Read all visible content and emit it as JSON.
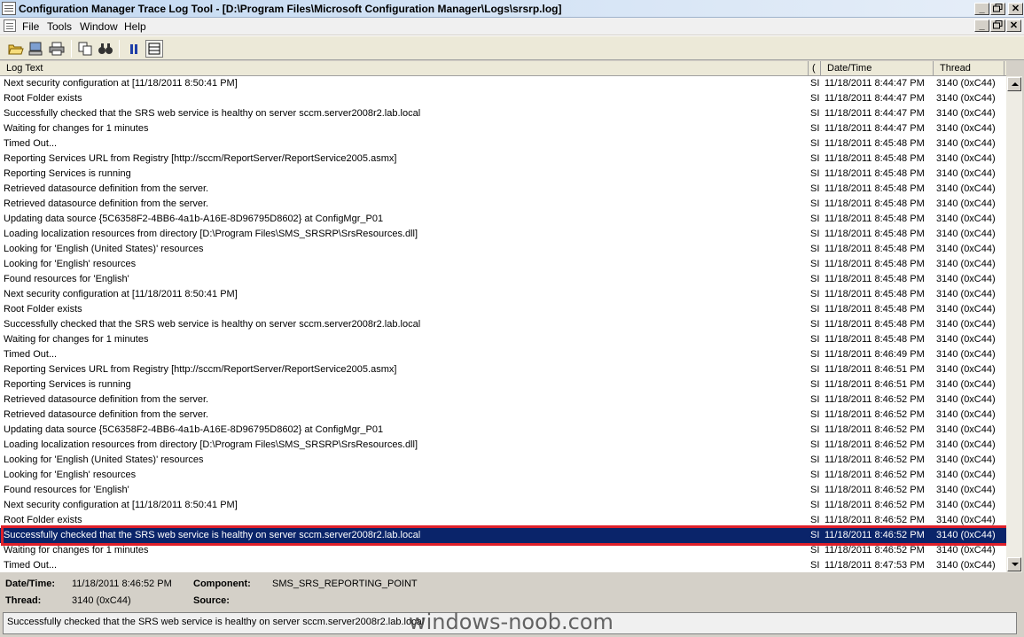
{
  "window": {
    "title": "Configuration Manager Trace Log Tool - [D:\\Program Files\\Microsoft Configuration Manager\\Logs\\srsrp.log]",
    "minimize_glyph": "_",
    "restore_glyph": "▫",
    "close_glyph": "✕"
  },
  "menu": [
    {
      "label": "File"
    },
    {
      "label": "Tools"
    },
    {
      "label": "Window"
    },
    {
      "label": "Help"
    }
  ],
  "columns": {
    "log_text": "Log Text",
    "component": "(",
    "datetime": "Date/Time",
    "thread": "Thread"
  },
  "rows": [
    {
      "text": "Next security configuration at [11/18/2011 8:50:41 PM]",
      "component": "SI",
      "datetime": "11/18/2011 8:44:47 PM",
      "thread": "3140 (0xC44)"
    },
    {
      "text": "Root Folder exists",
      "component": "SI",
      "datetime": "11/18/2011 8:44:47 PM",
      "thread": "3140 (0xC44)"
    },
    {
      "text": "Successfully checked that the SRS web service is healthy on server sccm.server2008r2.lab.local",
      "component": "SI",
      "datetime": "11/18/2011 8:44:47 PM",
      "thread": "3140 (0xC44)"
    },
    {
      "text": "Waiting for changes for 1 minutes",
      "component": "SI",
      "datetime": "11/18/2011 8:44:47 PM",
      "thread": "3140 (0xC44)"
    },
    {
      "text": "Timed Out...",
      "component": "SI",
      "datetime": "11/18/2011 8:45:48 PM",
      "thread": "3140 (0xC44)"
    },
    {
      "text": "Reporting Services URL from Registry [http://sccm/ReportServer/ReportService2005.asmx]",
      "component": "SI",
      "datetime": "11/18/2011 8:45:48 PM",
      "thread": "3140 (0xC44)"
    },
    {
      "text": "Reporting Services is running",
      "component": "SI",
      "datetime": "11/18/2011 8:45:48 PM",
      "thread": "3140 (0xC44)"
    },
    {
      "text": "Retrieved datasource definition from the server.",
      "component": "SI",
      "datetime": "11/18/2011 8:45:48 PM",
      "thread": "3140 (0xC44)"
    },
    {
      "text": "Retrieved datasource definition from the server.",
      "component": "SI",
      "datetime": "11/18/2011 8:45:48 PM",
      "thread": "3140 (0xC44)"
    },
    {
      "text": "Updating data source {5C6358F2-4BB6-4a1b-A16E-8D96795D8602} at ConfigMgr_P01",
      "component": "SI",
      "datetime": "11/18/2011 8:45:48 PM",
      "thread": "3140 (0xC44)"
    },
    {
      "text": "Loading localization resources from directory [D:\\Program Files\\SMS_SRSRP\\SrsResources.dll]",
      "component": "SI",
      "datetime": "11/18/2011 8:45:48 PM",
      "thread": "3140 (0xC44)"
    },
    {
      "text": "Looking for 'English (United States)' resources",
      "component": "SI",
      "datetime": "11/18/2011 8:45:48 PM",
      "thread": "3140 (0xC44)"
    },
    {
      "text": "Looking for 'English' resources",
      "component": "SI",
      "datetime": "11/18/2011 8:45:48 PM",
      "thread": "3140 (0xC44)"
    },
    {
      "text": "Found resources for 'English'",
      "component": "SI",
      "datetime": "11/18/2011 8:45:48 PM",
      "thread": "3140 (0xC44)"
    },
    {
      "text": "Next security configuration at [11/18/2011 8:50:41 PM]",
      "component": "SI",
      "datetime": "11/18/2011 8:45:48 PM",
      "thread": "3140 (0xC44)"
    },
    {
      "text": "Root Folder exists",
      "component": "SI",
      "datetime": "11/18/2011 8:45:48 PM",
      "thread": "3140 (0xC44)"
    },
    {
      "text": "Successfully checked that the SRS web service is healthy on server sccm.server2008r2.lab.local",
      "component": "SI",
      "datetime": "11/18/2011 8:45:48 PM",
      "thread": "3140 (0xC44)"
    },
    {
      "text": "Waiting for changes for 1 minutes",
      "component": "SI",
      "datetime": "11/18/2011 8:45:48 PM",
      "thread": "3140 (0xC44)"
    },
    {
      "text": "Timed Out...",
      "component": "SI",
      "datetime": "11/18/2011 8:46:49 PM",
      "thread": "3140 (0xC44)"
    },
    {
      "text": "Reporting Services URL from Registry [http://sccm/ReportServer/ReportService2005.asmx]",
      "component": "SI",
      "datetime": "11/18/2011 8:46:51 PM",
      "thread": "3140 (0xC44)"
    },
    {
      "text": "Reporting Services is running",
      "component": "SI",
      "datetime": "11/18/2011 8:46:51 PM",
      "thread": "3140 (0xC44)"
    },
    {
      "text": "Retrieved datasource definition from the server.",
      "component": "SI",
      "datetime": "11/18/2011 8:46:52 PM",
      "thread": "3140 (0xC44)"
    },
    {
      "text": "Retrieved datasource definition from the server.",
      "component": "SI",
      "datetime": "11/18/2011 8:46:52 PM",
      "thread": "3140 (0xC44)"
    },
    {
      "text": "Updating data source {5C6358F2-4BB6-4a1b-A16E-8D96795D8602} at ConfigMgr_P01",
      "component": "SI",
      "datetime": "11/18/2011 8:46:52 PM",
      "thread": "3140 (0xC44)"
    },
    {
      "text": "Loading localization resources from directory [D:\\Program Files\\SMS_SRSRP\\SrsResources.dll]",
      "component": "SI",
      "datetime": "11/18/2011 8:46:52 PM",
      "thread": "3140 (0xC44)"
    },
    {
      "text": "Looking for 'English (United States)' resources",
      "component": "SI",
      "datetime": "11/18/2011 8:46:52 PM",
      "thread": "3140 (0xC44)"
    },
    {
      "text": "Looking for 'English' resources",
      "component": "SI",
      "datetime": "11/18/2011 8:46:52 PM",
      "thread": "3140 (0xC44)"
    },
    {
      "text": "Found resources for 'English'",
      "component": "SI",
      "datetime": "11/18/2011 8:46:52 PM",
      "thread": "3140 (0xC44)"
    },
    {
      "text": "Next security configuration at [11/18/2011 8:50:41 PM]",
      "component": "SI",
      "datetime": "11/18/2011 8:46:52 PM",
      "thread": "3140 (0xC44)"
    },
    {
      "text": "Root Folder exists",
      "component": "SI",
      "datetime": "11/18/2011 8:46:52 PM",
      "thread": "3140 (0xC44)"
    },
    {
      "text": "Successfully checked that the SRS web service is healthy on server sccm.server2008r2.lab.local",
      "component": "SI",
      "datetime": "11/18/2011 8:46:52 PM",
      "thread": "3140 (0xC44)",
      "selected": true
    },
    {
      "text": "Waiting for changes for 1 minutes",
      "component": "SI",
      "datetime": "11/18/2011 8:46:52 PM",
      "thread": "3140 (0xC44)"
    },
    {
      "text": "Timed Out...",
      "component": "SI",
      "datetime": "11/18/2011 8:47:53 PM",
      "thread": "3140 (0xC44)"
    }
  ],
  "details": {
    "datetime_label": "Date/Time:",
    "datetime_value": "11/18/2011 8:46:52 PM",
    "component_label": "Component:",
    "component_value": "SMS_SRS_REPORTING_POINT",
    "thread_label": "Thread:",
    "thread_value": "3140 (0xC44)",
    "source_label": "Source:",
    "source_value": ""
  },
  "message": "Successfully checked that the SRS web service is healthy on server sccm.server2008r2.lab.local",
  "watermark": "windows-noob.com",
  "colors": {
    "selection": "#0a246a",
    "highlight_box": "#e0202a"
  }
}
